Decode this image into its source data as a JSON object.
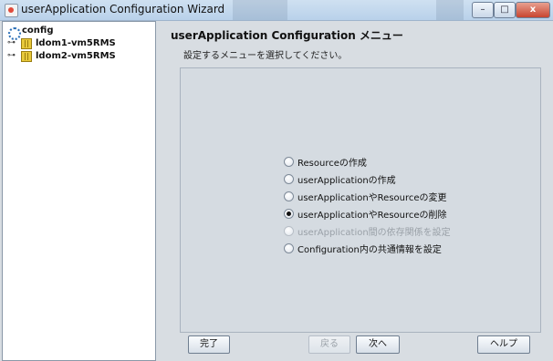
{
  "window": {
    "title": "userApplication Configuration Wizard",
    "minimize_label": "–",
    "maximize_label": "□",
    "close_label": "x"
  },
  "tree": {
    "root": {
      "label": "config",
      "icon": "config-icon"
    },
    "children": [
      {
        "label": "ldom1-vm5RMS",
        "icon": "folder-icon"
      },
      {
        "label": "ldom2-vm5RMS",
        "icon": "folder-icon"
      }
    ],
    "expand_handle": "⊶"
  },
  "main": {
    "heading": "userApplication Configuration メニュー",
    "instruction": "設定するメニューを選択してください。",
    "options": [
      {
        "label": "Resourceの作成",
        "checked": false,
        "enabled": true
      },
      {
        "label": "userApplicationの作成",
        "checked": false,
        "enabled": true
      },
      {
        "label": "userApplicationやResourceの変更",
        "checked": false,
        "enabled": true
      },
      {
        "label": "userApplicationやResourceの削除",
        "checked": true,
        "enabled": true
      },
      {
        "label": "userApplication間の依存関係を設定",
        "checked": false,
        "enabled": false
      },
      {
        "label": "Configuration内の共通情報を設定",
        "checked": false,
        "enabled": true
      }
    ]
  },
  "buttons": {
    "finish": "完了",
    "back": "戻る",
    "next": "次へ",
    "help": "ヘルプ"
  }
}
